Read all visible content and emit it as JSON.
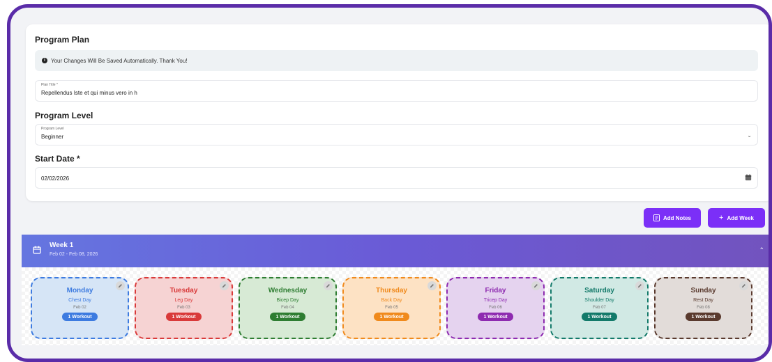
{
  "plan": {
    "section_title": "Program Plan",
    "info_text": "Your Changes Will Be Saved Automatically. Thank You!",
    "plan_title": {
      "label": "Plan Title *",
      "value": "Repellendus Iste et qui minus vero in h"
    },
    "level_section": "Program Level",
    "level": {
      "label": "Program Level",
      "value": "Beginner"
    },
    "start_section": "Start Date *",
    "start_date": "02/02/2026"
  },
  "actions": {
    "add_notes": "Add Notes",
    "add_week": "Add Week"
  },
  "week": {
    "title": "Week 1",
    "range": "Feb 02 - Feb 08, 2026"
  },
  "days": [
    {
      "name": "Monday",
      "type": "Chest Day",
      "date": "Feb 02",
      "workouts": "1 Workout",
      "color": "#3d7be0",
      "bg": "#d6e5f6"
    },
    {
      "name": "Tuesday",
      "type": "Leg Day",
      "date": "Feb 03",
      "workouts": "1 Workout",
      "color": "#d93a3a",
      "bg": "#f6d3d3"
    },
    {
      "name": "Wednesday",
      "type": "Bicep Day",
      "date": "Feb 04",
      "workouts": "1 Workout",
      "color": "#2e7d32",
      "bg": "#d7ead5"
    },
    {
      "name": "Thursday",
      "type": "Back Day",
      "date": "Feb 05",
      "workouts": "1 Workout",
      "color": "#f08a1c",
      "bg": "#fde2c4"
    },
    {
      "name": "Friday",
      "type": "Tricep Day",
      "date": "Feb 06",
      "workouts": "1 Workout",
      "color": "#8e2bb0",
      "bg": "#e5d3ef"
    },
    {
      "name": "Saturday",
      "type": "Shoulder Day",
      "date": "Feb 07",
      "workouts": "1 Workout",
      "color": "#137a6a",
      "bg": "#d1e9e4"
    },
    {
      "name": "Sunday",
      "type": "Rest Day",
      "date": "Feb 08",
      "workouts": "1 Workout",
      "color": "#5a3a2e",
      "bg": "#e2dcd9"
    }
  ],
  "colors": {
    "accent": "#7b2ff7",
    "frame": "#5a2ca8"
  }
}
